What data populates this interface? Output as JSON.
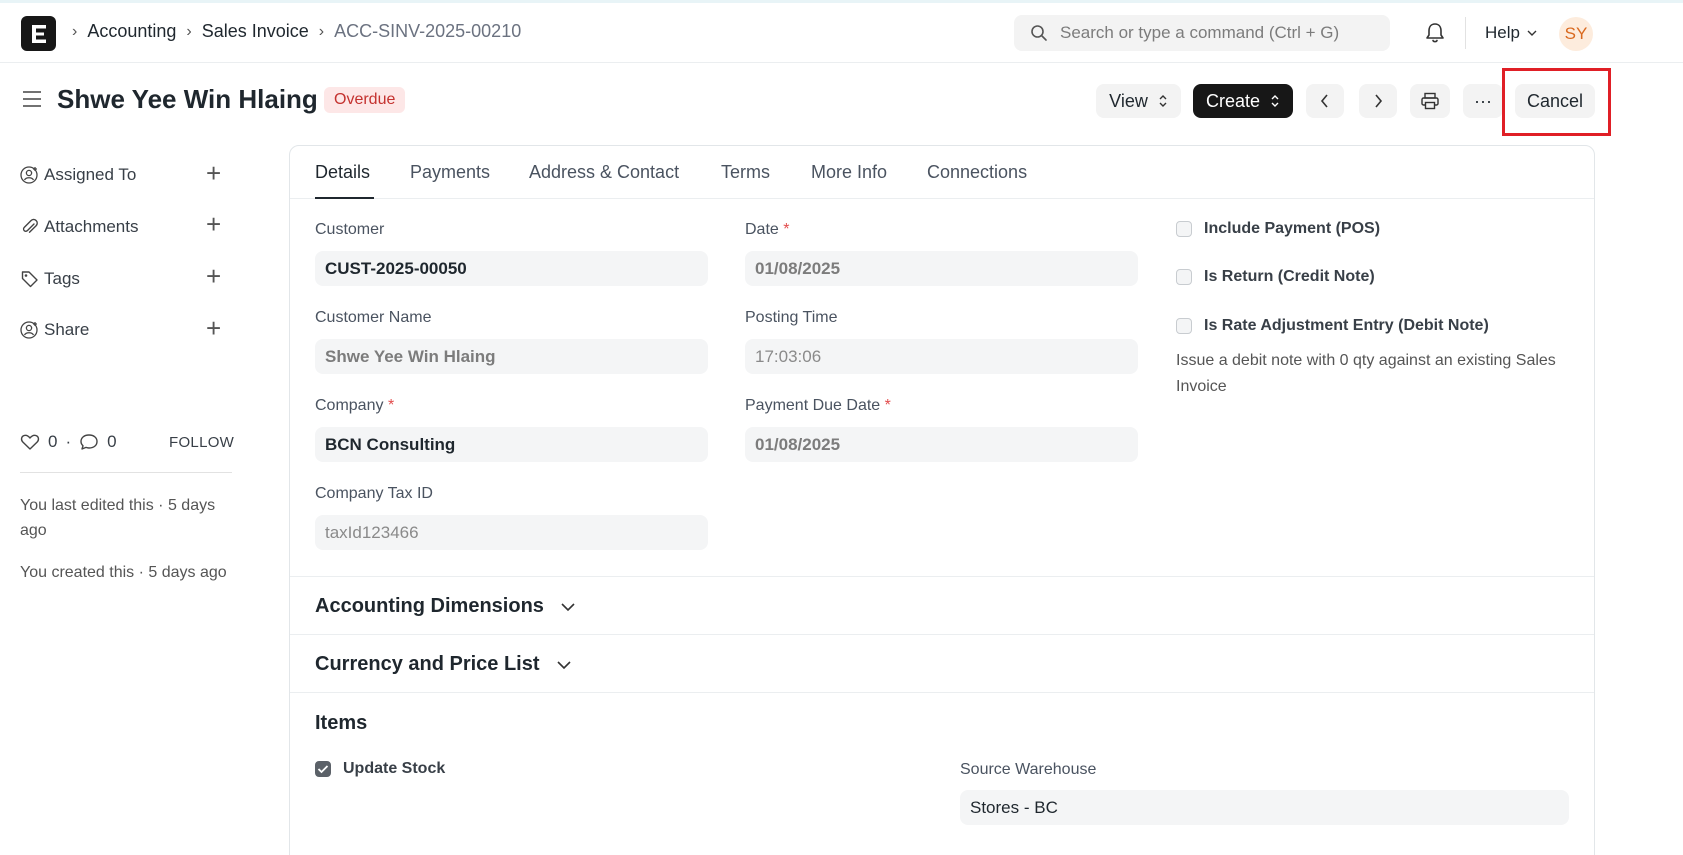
{
  "navbar": {
    "breadcrumbs": [
      "Accounting",
      "Sales Invoice",
      "ACC-SINV-2025-00210"
    ],
    "search_placeholder": "Search or type a command (Ctrl + G)",
    "help_label": "Help",
    "avatar_initials": "SY"
  },
  "header": {
    "title": "Shwe Yee Win Hlaing",
    "status": "Overdue",
    "view_label": "View",
    "create_label": "Create",
    "more_label": "···",
    "cancel_label": "Cancel"
  },
  "sidebar": {
    "items": [
      {
        "label": "Assigned To",
        "icon": "user-plus-icon"
      },
      {
        "label": "Attachments",
        "icon": "paperclip-icon"
      },
      {
        "label": "Tags",
        "icon": "tag-icon"
      },
      {
        "label": "Share",
        "icon": "share-user-icon"
      }
    ],
    "likes": "0",
    "comments": "0",
    "follow_label": "FOLLOW",
    "last_edited": "You last edited this · 5 days ago",
    "created": "You created this · 5 days ago"
  },
  "tabs": [
    "Details",
    "Payments",
    "Address & Contact",
    "Terms",
    "More Info",
    "Connections"
  ],
  "form": {
    "customer_label": "Customer",
    "customer_value": "CUST-2025-00050",
    "customer_name_label": "Customer Name",
    "customer_name_value": "Shwe Yee Win Hlaing",
    "company_label": "Company",
    "company_value": "BCN Consulting",
    "company_tax_label": "Company Tax ID",
    "company_tax_value": "taxId123466",
    "date_label": "Date",
    "date_value": "01/08/2025",
    "posting_time_label": "Posting Time",
    "posting_time_value": "17:03:06",
    "due_date_label": "Payment Due Date",
    "due_date_value": "01/08/2025",
    "required_mark": "*",
    "include_payment_label": "Include Payment (POS)",
    "is_return_label": "Is Return (Credit Note)",
    "rate_adjustment_label": "Is Rate Adjustment Entry (Debit Note)",
    "rate_adjustment_desc": "Issue a debit note with 0 qty against an existing Sales Invoice"
  },
  "sections": {
    "accounting_dimensions": "Accounting Dimensions",
    "currency_price_list": "Currency and Price List",
    "items": "Items",
    "update_stock_label": "Update Stock",
    "update_stock_checked": true,
    "source_warehouse_label": "Source Warehouse",
    "source_warehouse_value": "Stores - BC"
  }
}
